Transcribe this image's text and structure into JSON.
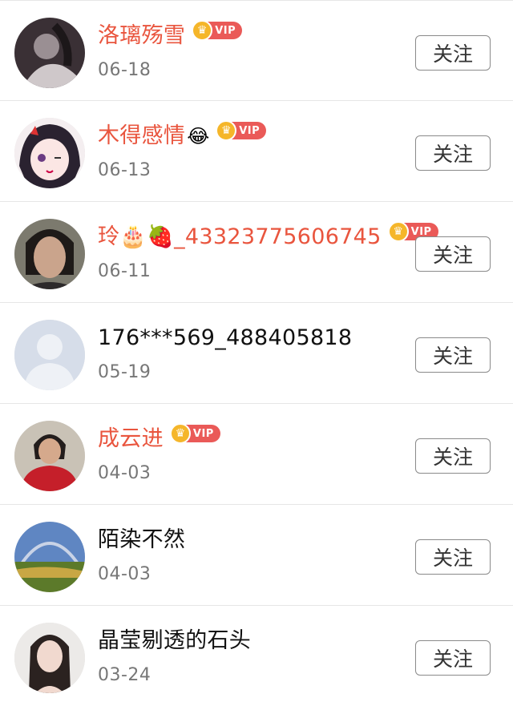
{
  "follow_label": "关注",
  "vip_label": "VIP",
  "users": [
    {
      "name": "洛璃殇雪",
      "date": "06-18",
      "vip": true,
      "emoji": ""
    },
    {
      "name": "木得感情",
      "date": "06-13",
      "vip": true,
      "emoji": "😂"
    },
    {
      "name": "玲🎂🍓_43323775606745",
      "date": "06-11",
      "vip": true,
      "emoji": ""
    },
    {
      "name": "176***569_488405818",
      "date": "05-19",
      "vip": false,
      "emoji": ""
    },
    {
      "name": "成云进",
      "date": "04-03",
      "vip": true,
      "emoji": ""
    },
    {
      "name": "陌染不然",
      "date": "04-03",
      "vip": false,
      "emoji": ""
    },
    {
      "name": "晶莹剔透的石头",
      "date": "03-24",
      "vip": false,
      "emoji": ""
    }
  ],
  "colors": {
    "vip_name": "#e9553e",
    "vip_badge": "#ea5a58",
    "crown": "#f5b62a"
  }
}
